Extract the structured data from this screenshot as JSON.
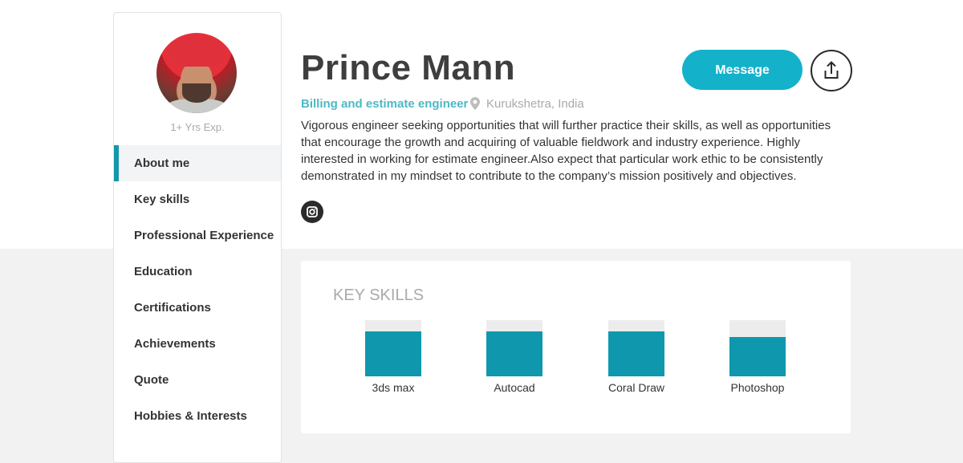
{
  "profile": {
    "name": "Prince Mann",
    "role": "Billing and estimate engineer",
    "location": "Kurukshetra, India",
    "experience": "1+ Yrs Exp.",
    "bio": "Vigorous engineer seeking opportunities that will further practice their skills, as well as opportunities that encourage the growth and acquiring of valuable fieldwork and industry experience. Highly interested in working for estimate engineer.Also expect that particular work ethic to be consistently demonstrated in my mindset to contribute to the company’s mission positively and objectives."
  },
  "actions": {
    "message_label": "Message",
    "share_icon": "share-icon"
  },
  "social": {
    "instagram_icon": "instagram-icon"
  },
  "sidebar": {
    "items": [
      {
        "label": "About me",
        "active": true
      },
      {
        "label": "Key skills",
        "active": false
      },
      {
        "label": "Professional Experience",
        "active": false
      },
      {
        "label": "Education",
        "active": false
      },
      {
        "label": "Certifications",
        "active": false
      },
      {
        "label": "Achievements",
        "active": false
      },
      {
        "label": "Quote",
        "active": false
      },
      {
        "label": "Hobbies & Interests",
        "active": false
      }
    ]
  },
  "skills": {
    "title": "KEY SKILLS",
    "items": [
      {
        "label": "3ds max",
        "level": 0.8
      },
      {
        "label": "Autocad",
        "level": 0.8
      },
      {
        "label": "Coral Draw",
        "level": 0.8
      },
      {
        "label": "Photoshop",
        "level": 0.7
      }
    ]
  },
  "colors": {
    "accent": "#13b2ca",
    "bar_fill": "#0f98ad",
    "role_text": "#4db8c5"
  }
}
